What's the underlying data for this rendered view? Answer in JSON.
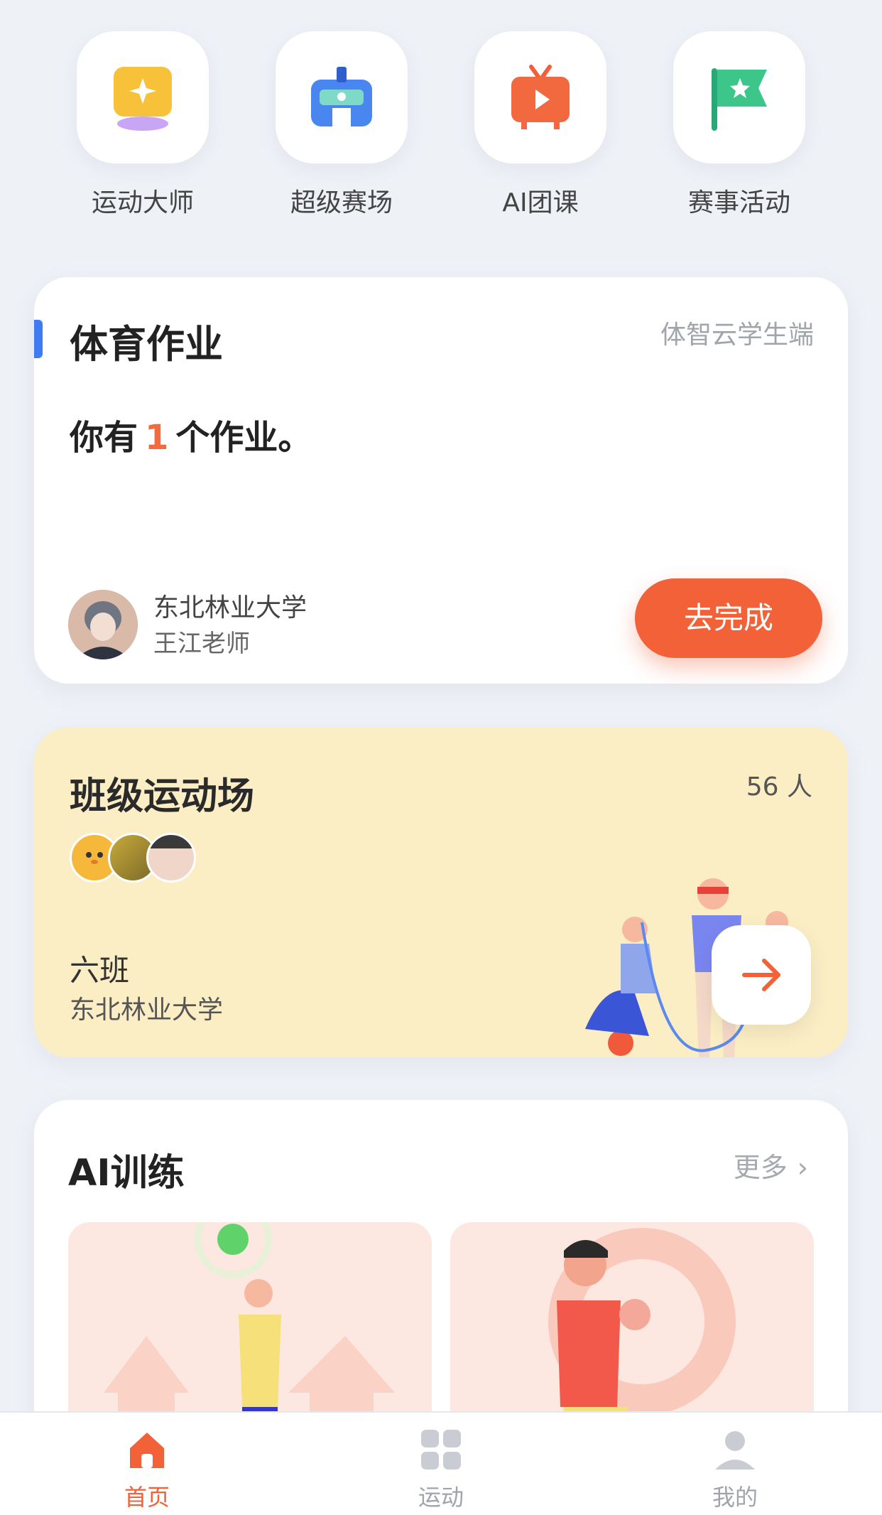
{
  "quick_actions": [
    {
      "label": "运动大师",
      "icon": "star-badge-icon"
    },
    {
      "label": "超级赛场",
      "icon": "stadium-icon"
    },
    {
      "label": "AI团课",
      "icon": "tv-play-icon"
    },
    {
      "label": "赛事活动",
      "icon": "flag-star-icon"
    }
  ],
  "homework": {
    "title": "体育作业",
    "source": "体智云学生端",
    "msg_prefix": "你有",
    "count": "1",
    "msg_suffix": "个作业。",
    "school": "东北林业大学",
    "teacher": "王江老师",
    "button": "去完成"
  },
  "class_field": {
    "title": "班级运动场",
    "count": "56 人",
    "class_name": "六班",
    "school": "东北林业大学"
  },
  "ai_training": {
    "title": "AI训练",
    "more": "更多"
  },
  "tabbar": [
    {
      "label": "首页",
      "icon": "home-icon",
      "active": true
    },
    {
      "label": "运动",
      "icon": "grid-icon",
      "active": false
    },
    {
      "label": "我的",
      "icon": "user-icon",
      "active": false
    }
  ],
  "colors": {
    "accent": "#f26138",
    "blue_bar": "#3f7bf3",
    "class_bg": "#fbedc4"
  }
}
